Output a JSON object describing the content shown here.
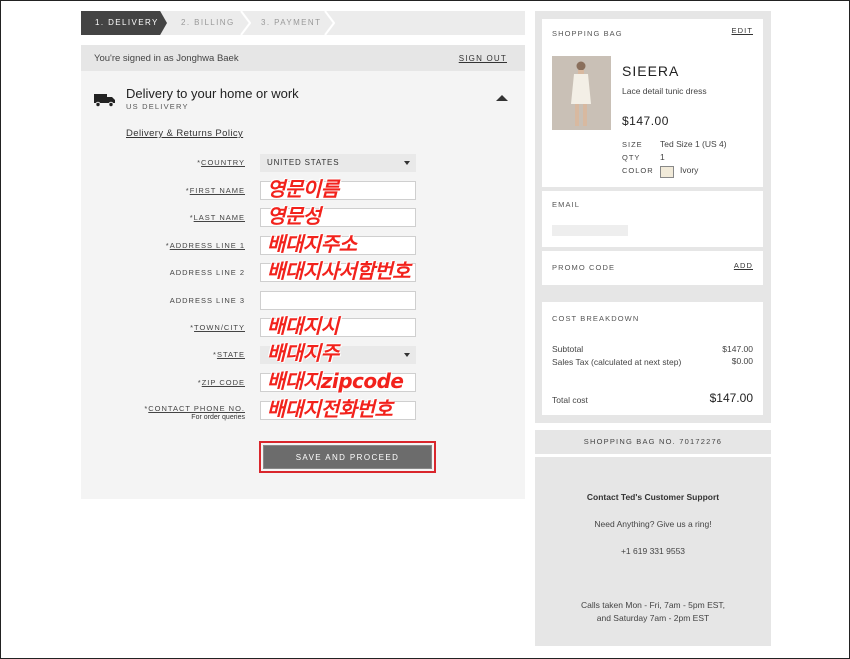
{
  "steps": [
    "1. DELIVERY",
    "2. BILLING",
    "3. PAYMENT"
  ],
  "signed_in": {
    "text": "You're signed in as Jonghwa Baek",
    "sign_out": "SIGN OUT"
  },
  "delivery": {
    "title": "Delivery to your home or work",
    "subtitle": "US DELIVERY",
    "policy_link": "Delivery & Returns Policy"
  },
  "form": {
    "country": {
      "label": "COUNTRY",
      "value": "UNITED STATES"
    },
    "first_name": {
      "label": "FIRST NAME",
      "annotation": "영문이름"
    },
    "last_name": {
      "label": "LAST NAME",
      "annotation": "영문성"
    },
    "address1": {
      "label": "ADDRESS LINE 1",
      "annotation": "배대지주소"
    },
    "address2": {
      "label": "ADDRESS LINE 2",
      "annotation": "배대지사서함번호"
    },
    "address3": {
      "label": "ADDRESS LINE 3"
    },
    "city": {
      "label": "TOWN/CITY",
      "annotation": "배대지시"
    },
    "state": {
      "label": "STATE",
      "annotation": "배대지주"
    },
    "zip": {
      "label": "ZIP CODE",
      "annotation": "배대지zipcode"
    },
    "phone": {
      "label": "CONTACT PHONE NO.",
      "sublabel": "For order queries",
      "annotation": "배대지전화번호"
    },
    "required_mark": "*"
  },
  "save_button": "SAVE AND PROCEED",
  "bag": {
    "header": "SHOPPING BAG",
    "edit": "EDIT",
    "product": {
      "name": "SIEERA",
      "description": "Lace detail tunic dress",
      "price": "$147.00",
      "size_label": "SIZE",
      "size_value": "Ted Size 1 (US 4)",
      "qty_label": "QTY",
      "qty_value": "1",
      "color_label": "COLOR",
      "color_value": "Ivory",
      "swatch_color": "#f1ead9"
    }
  },
  "email": {
    "header": "EMAIL"
  },
  "promo": {
    "header": "PROMO CODE",
    "add": "ADD"
  },
  "cost": {
    "header": "COST BREAKDOWN",
    "subtotal_label": "Subtotal",
    "subtotal_value": "$147.00",
    "tax_label": "Sales Tax (calculated at next step)",
    "tax_value": "$0.00",
    "total_label": "Total cost",
    "total_value": "$147.00"
  },
  "bag_number": "SHOPPING BAG NO. 70172276",
  "support": {
    "title": "Contact Ted's Customer Support",
    "line1": "Need Anything? Give us a ring!",
    "phone": "+1 619 331 9553",
    "hours1": "Calls taken Mon - Fri, 7am - 5pm EST,",
    "hours2": "and Saturday 7am - 2pm EST"
  },
  "colors": {
    "active_step": "#444444",
    "annotation": "#f2221c",
    "highlight_border": "#d9262c",
    "button": "#6c6c6c"
  }
}
